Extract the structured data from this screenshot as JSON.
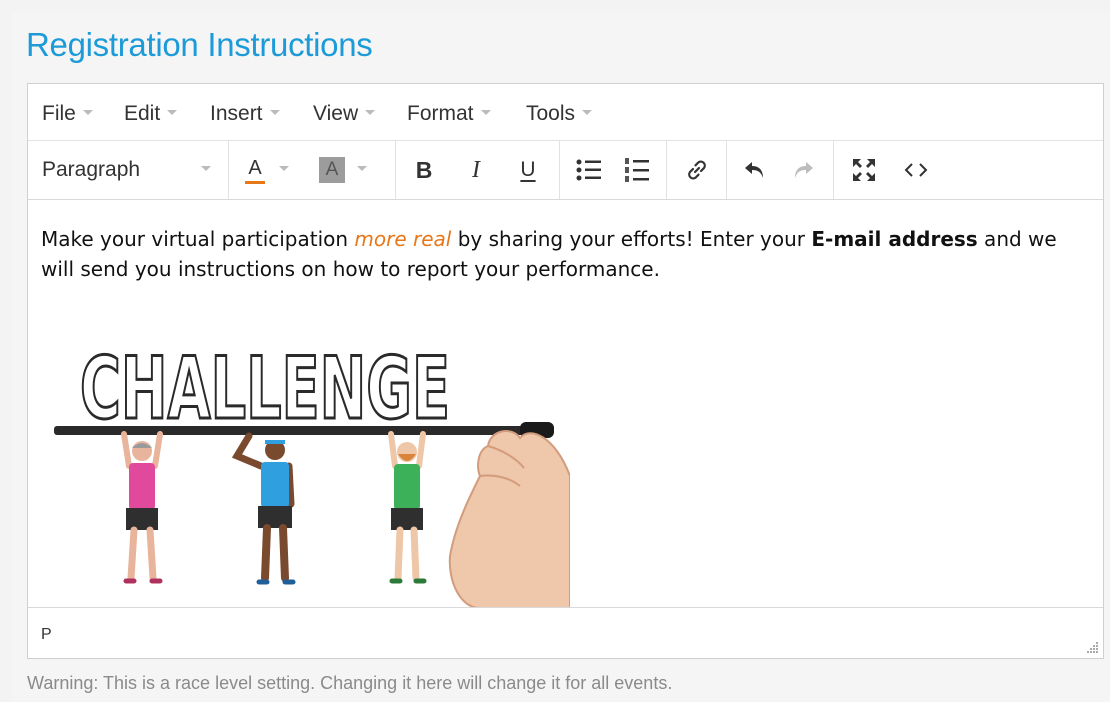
{
  "section": {
    "title": "Registration Instructions"
  },
  "editor": {
    "menubar": [
      {
        "label": "File"
      },
      {
        "label": "Edit"
      },
      {
        "label": "Insert"
      },
      {
        "label": "View"
      },
      {
        "label": "Format"
      },
      {
        "label": "Tools"
      }
    ],
    "toolbar": {
      "block_format": "Paragraph",
      "text_color_glyph": "A",
      "bg_color_glyph": "A",
      "bold_glyph": "B",
      "italic_glyph": "I",
      "underline_glyph": "U",
      "text_color_accent": "#e8771a",
      "bg_color_swatch": "#9c9c9c",
      "icons": [
        "text-color-icon",
        "background-color-icon",
        "bold-icon",
        "italic-icon",
        "underline-icon",
        "bullet-list-icon",
        "numbered-list-icon",
        "link-icon",
        "undo-icon",
        "redo-icon",
        "fullscreen-icon",
        "source-code-icon"
      ]
    },
    "content": {
      "text_1": "Make your virtual participation ",
      "emphasis": "more real",
      "text_2": " by sharing your efforts! Enter your ",
      "strong": "E-mail address",
      "text_3": " and we will send you instructions on how to report your performance.",
      "emphasis_color": "#e8771a",
      "image": {
        "word": "CHALLENGE",
        "shirt_colors": [
          "#e14a9c",
          "#2f9fe0",
          "#3cb15a"
        ]
      }
    },
    "statusbar": {
      "path": "P"
    }
  },
  "warning": "Warning: This is a race level setting. Changing it here will change it for all events.",
  "colors": {
    "title": "#1c9bd8",
    "warning_text": "#8a8a8a",
    "border": "#cfcfcf"
  }
}
